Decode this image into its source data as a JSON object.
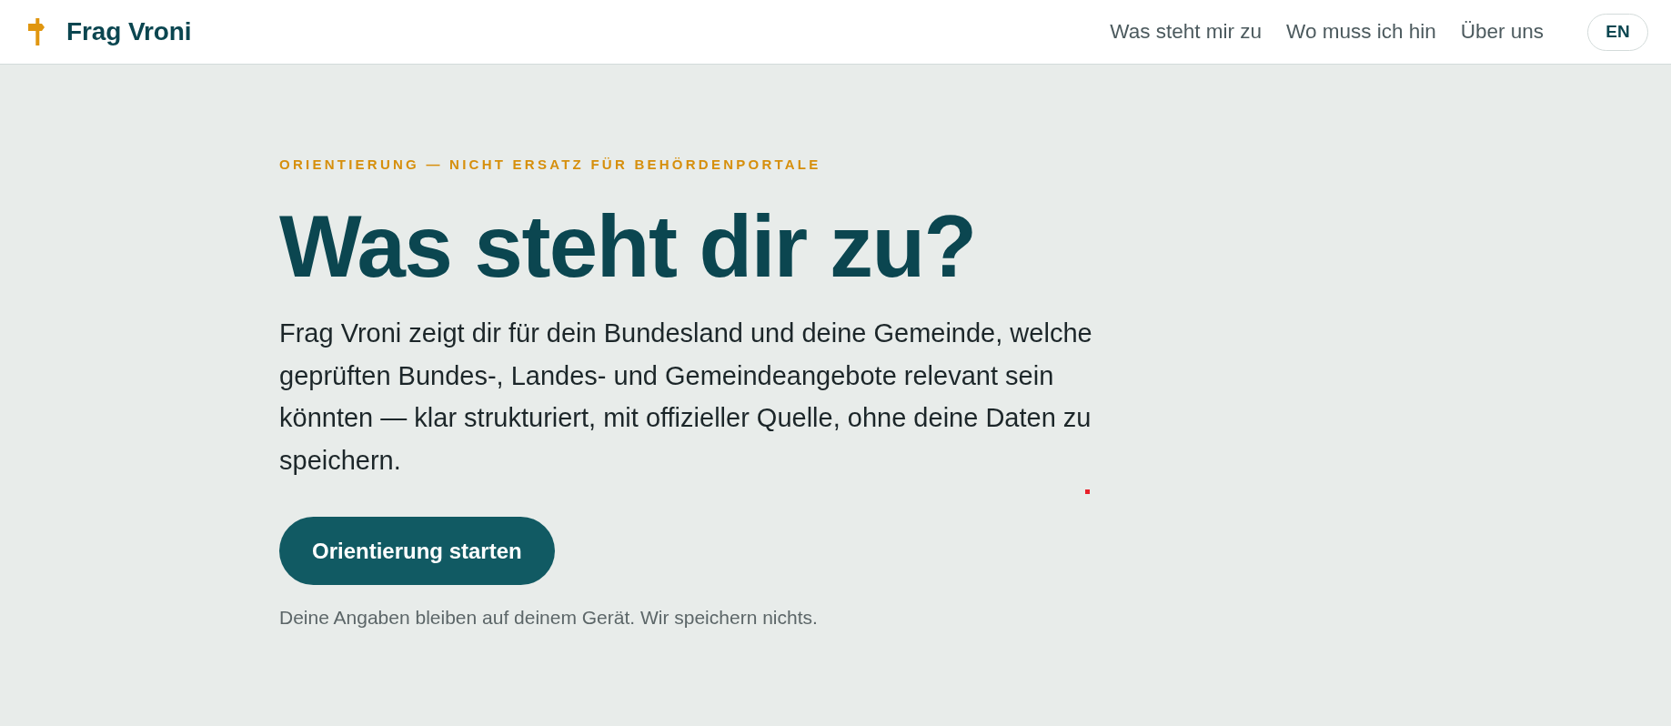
{
  "header": {
    "brand": "Frag Vroni",
    "nav": [
      "Was steht mir zu",
      "Wo muss ich hin",
      "Über uns"
    ],
    "language_button": "EN"
  },
  "hero": {
    "eyebrow": "ORIENTIERUNG — NICHT ERSATZ FÜR BEHÖRDENPORTALE",
    "title": "Was steht dir zu?",
    "intro": "Frag Vroni zeigt dir für dein Bundesland und deine Gemeinde, welche geprüften Bundes-, Landes- und Gemeindeangebote relevant sein könnten — klar strukturiert, mit offizieller Quelle, ohne deine Daten zu speichern.",
    "button": "Orientierung starten",
    "note": "Deine Angaben bleiben auf deinem Gerät. Wir speichern nichts."
  }
}
